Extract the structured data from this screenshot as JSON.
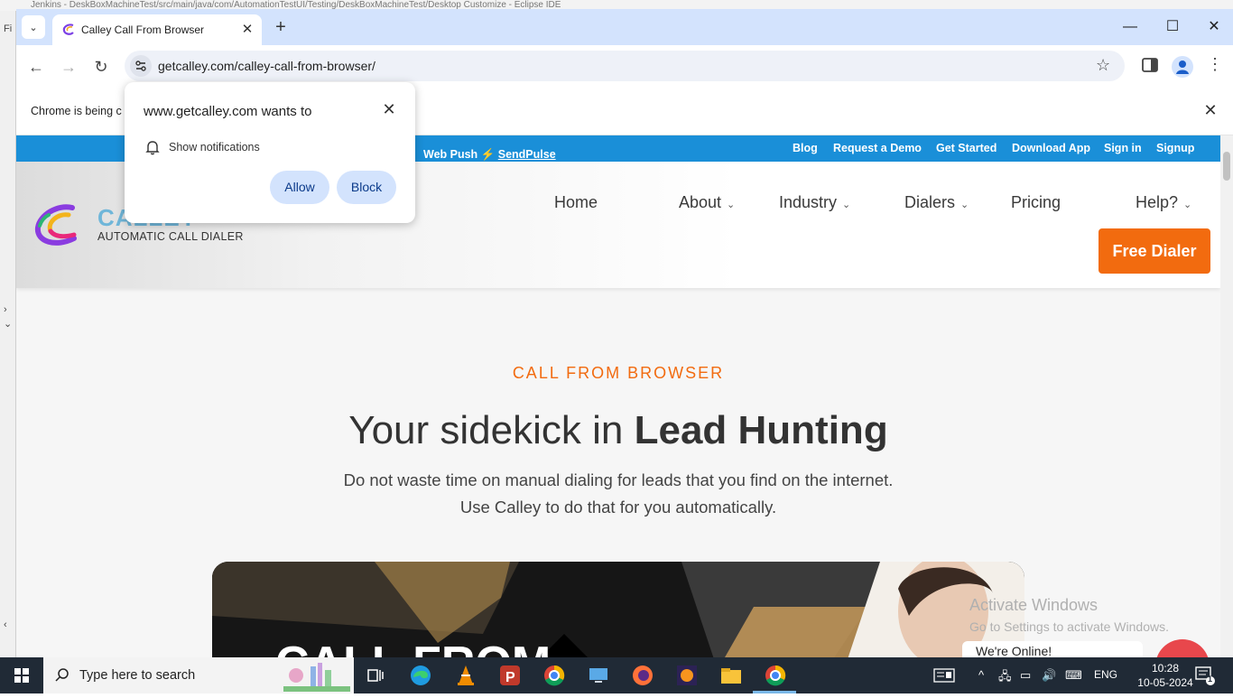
{
  "ide": {
    "title": "Jenkins - DeskBoxMachineTest/src/main/java/com/AutomationTestUI/Testing/DeskBoxMachineTest/Desktop Customize - Eclipse IDE",
    "menu_glyph": "Fi"
  },
  "chrome": {
    "tab_title": "Calley Call From Browser",
    "url": "getcalley.com/calley-call-from-browser/",
    "infobar_text": "Chrome is being c",
    "notification": {
      "title": "www.getcalley.com wants to",
      "permission": "Show notifications",
      "allow_label": "Allow",
      "block_label": "Block"
    }
  },
  "site": {
    "webpush_prefix": "Web Push",
    "webpush_brand": "SendPulse",
    "top_links": [
      "Blog",
      "Request a Demo",
      "Get Started",
      "Download App",
      "Sign in",
      "Signup"
    ],
    "logo_word": "CALLEY",
    "logo_tagline": "AUTOMATIC CALL DIALER",
    "nav": {
      "home": "Home",
      "about": "About",
      "industry": "Industry",
      "dialers": "Dialers",
      "pricing": "Pricing",
      "help": "Help?"
    },
    "cta_label": "Free Dialer",
    "hero": {
      "kicker": "CALL FROM BROWSER",
      "title_plain": "Your sidekick in ",
      "title_bold": "Lead Hunting",
      "sub1": "Do not waste time on manual dialing for leads that you find on the internet.",
      "sub2": "Use Calley to do that for you automatically.",
      "image_text": "CALL FROM"
    },
    "activate_title": "Activate Windows",
    "activate_sub": "Go to Settings to activate Windows.",
    "chat_text": "We're Online!"
  },
  "taskbar": {
    "search_placeholder": "Type here to search",
    "lang": "ENG",
    "time": "10:28",
    "date": "10-05-2024",
    "notification_count": "1"
  },
  "colors": {
    "accent_orange": "#f26b0f",
    "topbar_blue": "#1a8fd8",
    "chrome_blue": "#d3e3fd"
  }
}
